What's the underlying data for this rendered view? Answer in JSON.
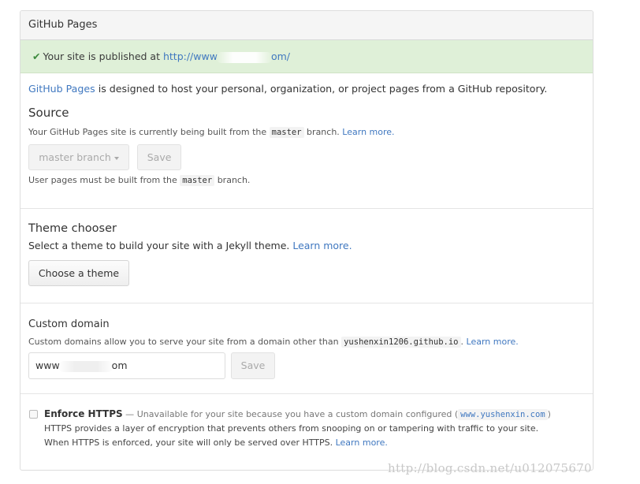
{
  "panel": {
    "title": "GitHub Pages"
  },
  "flash": {
    "check_icon": "checkmark-icon",
    "prefix": "Your site is published at ",
    "url_start": "http://www",
    "url_end": "om/"
  },
  "intro": {
    "link": "GitHub Pages",
    "text": " is designed to host your personal, organization, or project pages from a GitHub repository."
  },
  "source": {
    "title": "Source",
    "desc_pre": "Your GitHub Pages site is currently being built from the ",
    "desc_code": "master",
    "desc_post": " branch. ",
    "learn_more": "Learn more.",
    "branch_button": "master branch",
    "save_button": "Save",
    "note_pre": "User pages must be built from the ",
    "note_code": "master",
    "note_post": " branch."
  },
  "theme": {
    "title": "Theme chooser",
    "desc": "Select a theme to build your site with a Jekyll theme. ",
    "learn_more": "Learn more.",
    "button": "Choose a theme"
  },
  "custom_domain": {
    "title": "Custom domain",
    "desc_pre": "Custom domains allow you to serve your site from a domain other than ",
    "desc_code": "yushenxin1206.github.io",
    "desc_post": ". ",
    "learn_more": "Learn more.",
    "value_start": "www",
    "value_end": "om",
    "save_button": "Save"
  },
  "https": {
    "label": "Enforce HTTPS",
    "dash": " — ",
    "unavailable_pre": "Unavailable for your site because you have a custom domain configured (",
    "unavailable_code": "www.yushenxin.com",
    "unavailable_post": ")",
    "line2": "HTTPS provides a layer of encryption that prevents others from snooping on or tampering with traffic to your site.",
    "line3": "When HTTPS is enforced, your site will only be served over HTTPS. ",
    "learn_more": "Learn more.",
    "checked": false
  },
  "watermark": "http://blog.csdn.net/u012075670",
  "colors": {
    "link": "#4078c0",
    "success_bg": "#dff0d8",
    "check": "#3c8a3c"
  }
}
